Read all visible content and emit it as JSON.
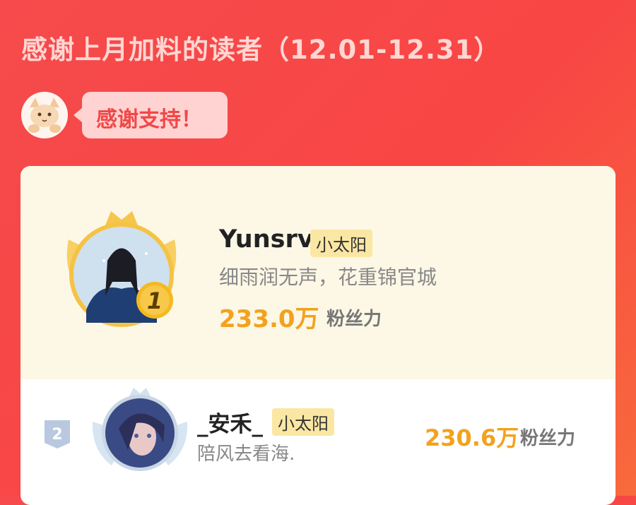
{
  "header": {
    "title": "感谢上月加料的读者（12.01-12.31）",
    "bubble_text": "感谢支持！"
  },
  "colors": {
    "background": "#f64a4c",
    "card_top": "#fdf7e6",
    "fan_power": "#f2a21e",
    "badge": "#fbe7a4"
  },
  "readers": [
    {
      "rank": "1",
      "name": "Yunsrv",
      "badge": "小太阳",
      "motto": "细雨润无声，花重锦官城",
      "fan_power": "233.0万",
      "fan_power_label": "粉丝力",
      "crown_icon": "gold-crown-icon"
    },
    {
      "rank": "2",
      "name": "_安禾_",
      "badge": "小太阳",
      "motto": "陪风去看海.",
      "fan_power": "230.6万",
      "fan_power_label": "粉丝力",
      "crown_icon": "silver-crown-icon"
    }
  ]
}
